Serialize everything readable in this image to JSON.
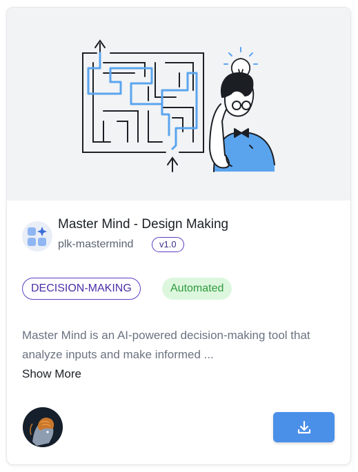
{
  "card": {
    "title": "Master Mind - Design Making",
    "slug": "plk-mastermind",
    "version": "v1.0",
    "tags": {
      "category": "DECISION-MAKING",
      "status": "Automated"
    },
    "description": "Master Mind is an AI-powered decision-making tool that analyze inputs and make informed ...",
    "show_more_label": "Show More",
    "icons": {
      "logo": "grid-sparkle-icon",
      "download": "download-icon",
      "avatar": "ai-head-avatar"
    }
  },
  "colors": {
    "accent": "#4a8fe8",
    "tag_border": "#5b3cc4",
    "status_bg": "#dcf7de",
    "status_text": "#2f9a3c"
  }
}
